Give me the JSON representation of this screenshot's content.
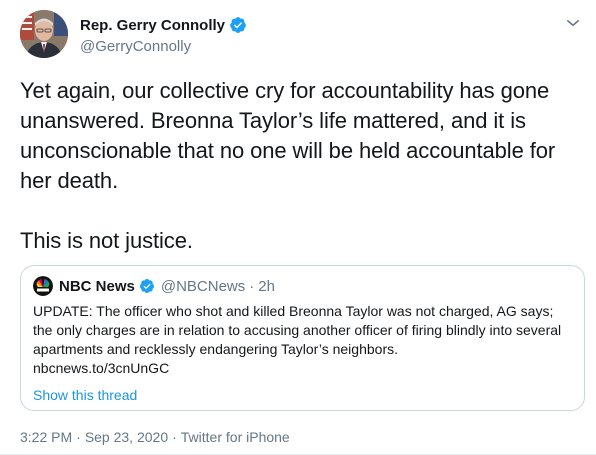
{
  "author": {
    "name": "Rep. Gerry Connolly",
    "handle": "@GerryConnolly",
    "verified": true,
    "avatar_icon": "congressman-portrait"
  },
  "menu_icon": "chevron-down-icon",
  "tweet": {
    "paragraphs": [
      "Yet again, our collective cry for accountability has gone unanswered. Breonna Taylor’s life mattered, and it is unconscionable that no one will be held accountable for her death.",
      "This is not justice."
    ]
  },
  "quote": {
    "name": "NBC News",
    "handle": "@NBCNews",
    "separator": "·",
    "time": "2h",
    "logo_icon": "nbc-peacock-logo",
    "text": "UPDATE: The officer who shot and killed Breonna Taylor was not charged, AG says; the only charges are in relation to accusing another officer of firing blindly into several apartments and recklessly endangering Taylor’s neighbors.",
    "link": "nbcnews.to/3cnUnGC",
    "show_thread": "Show this thread"
  },
  "meta": {
    "time": "3:22 PM",
    "sep1": "·",
    "date": "Sep 23, 2020",
    "sep2": "·",
    "source": "Twitter for iPhone"
  },
  "colors": {
    "verified": "#1da1f2",
    "link": "#1b95e0",
    "muted": "#657786",
    "border": "#ccd6dd"
  }
}
